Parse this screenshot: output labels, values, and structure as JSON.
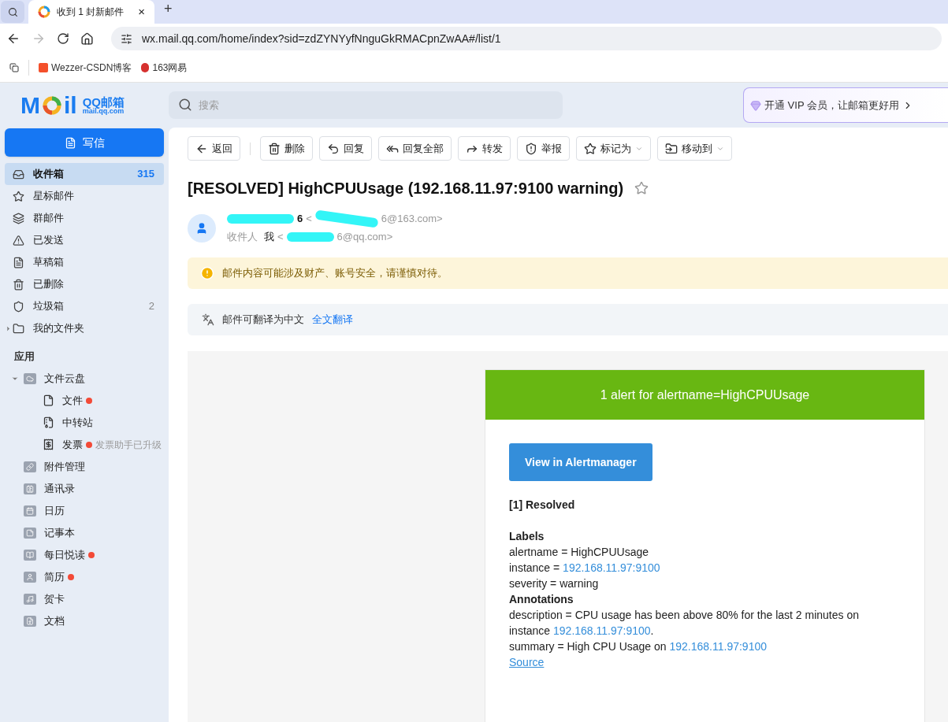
{
  "browser": {
    "tab": {
      "title": "收到 1 封新邮件",
      "close": "×",
      "new": "+"
    },
    "url": "wx.mail.qq.com/home/index?sid=zdZYNYyfNnguGkRMACpnZwAA#/list/1",
    "bookmarks": [
      "Wezzer-CSDN博客",
      "163网易"
    ]
  },
  "logo": {
    "text_start": "M",
    "text_end": "il",
    "name": "QQ邮箱",
    "domain": "mail.qq.com"
  },
  "search": {
    "placeholder": "搜索"
  },
  "vip_banner": "开通 VIP 会员，让邮箱更好用",
  "compose": "写信",
  "folders": [
    {
      "label": "收件箱",
      "count": "315",
      "selected": true
    },
    {
      "label": "星标邮件",
      "selected": false
    },
    {
      "label": "群邮件",
      "selected": false
    },
    {
      "label": "已发送",
      "selected": false
    },
    {
      "label": "草稿箱",
      "selected": false
    },
    {
      "label": "已删除",
      "selected": false
    },
    {
      "label": "垃圾箱",
      "count": "2",
      "selected": false
    },
    {
      "label": "我的文件夹",
      "expanded": false,
      "selected": false
    }
  ],
  "apps_heading": "应用",
  "apps": [
    {
      "label": "文件云盘",
      "expanded": true,
      "children": [
        {
          "label": "文件",
          "dot": true
        },
        {
          "label": "中转站",
          "dot": false
        },
        {
          "label": "发票",
          "dot": true,
          "note": "发票助手已升级"
        }
      ]
    },
    {
      "label": "附件管理",
      "dot": false
    },
    {
      "label": "通讯录",
      "dot": false
    },
    {
      "label": "日历",
      "dot": false
    },
    {
      "label": "记事本",
      "dot": false
    },
    {
      "label": "每日悦读",
      "dot": true
    },
    {
      "label": "简历",
      "dot": true
    },
    {
      "label": "贺卡",
      "dot": false
    },
    {
      "label": "文档",
      "dot": false
    }
  ],
  "toolbar": [
    {
      "label": "返回",
      "caret": false
    },
    {
      "label": "删除",
      "caret": false
    },
    {
      "label": "回复",
      "caret": false
    },
    {
      "label": "回复全部",
      "caret": false
    },
    {
      "label": "转发",
      "caret": false
    },
    {
      "label": "举报",
      "caret": false
    },
    {
      "label": "标记为",
      "caret": true
    },
    {
      "label": "移动到",
      "caret": true
    }
  ],
  "email": {
    "subject": "[RESOLVED] HighCPUUsage (192.168.11.97:9100 warning)",
    "starred": false,
    "sender_name_end": "6",
    "sender_email_start": "<",
    "sender_email_end": "6@163.com>",
    "recipient_label": "收件人",
    "recipient": "我",
    "recipient_email_start": "<",
    "recipient_email_end": "6@qq.com>",
    "warning": "邮件内容可能涉及财产、账号安全，请谨慎对待。",
    "translate_note": "邮件可翻译为中文",
    "translate_link": "全文翻译"
  },
  "alert": {
    "header": "1 alert for alertname=HighCPUUsage",
    "button": "View in Alertmanager",
    "status": "[1] Resolved",
    "labels_heading": "Labels",
    "lines": [
      {
        "kind": "plain",
        "text": "alertname = HighCPUUsage"
      },
      {
        "kind": "link",
        "text": "instance = ",
        "link": "192.168.11.97:9100"
      },
      {
        "kind": "plain",
        "text": "severity = warning"
      },
      {
        "kind": "heading",
        "text": "Annotations"
      },
      {
        "kind": "plain",
        "text": "description = CPU usage has been above 80% for the last 2 minutes on"
      },
      {
        "kind": "link",
        "text": "instance ",
        "link": "192.168.11.97:9100",
        "after": "."
      },
      {
        "kind": "link",
        "text": "summary = High CPU Usage on ",
        "link": "192.168.11.97:9100"
      }
    ],
    "source": "Source"
  }
}
